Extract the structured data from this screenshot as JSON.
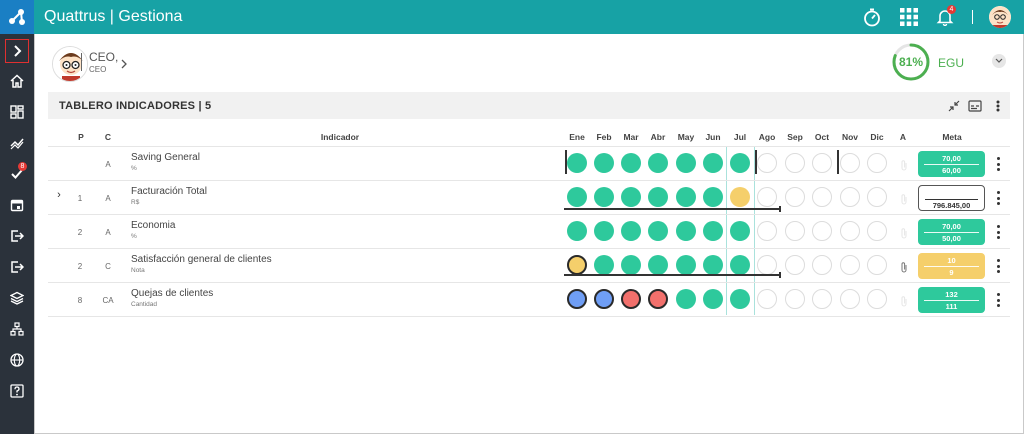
{
  "header": {
    "title": "Quattrus | Gestiona",
    "bell_count": "4"
  },
  "sidebar": {
    "items": [
      {
        "icon": "chevron-right-icon"
      },
      {
        "icon": "home-icon"
      },
      {
        "icon": "dashboard-icon"
      },
      {
        "icon": "trend-icon"
      },
      {
        "icon": "tasks-icon",
        "badge": "8"
      },
      {
        "icon": "calendar-icon"
      },
      {
        "icon": "exit-icon"
      },
      {
        "icon": "exit-icon"
      },
      {
        "icon": "layers-icon"
      },
      {
        "icon": "org-chart-icon"
      },
      {
        "icon": "globe-icon"
      },
      {
        "icon": "help-icon"
      }
    ]
  },
  "user": {
    "role": "CEO,",
    "sub": "CEO"
  },
  "score": {
    "percent": "81%",
    "value": 0.81,
    "unit": "EGU"
  },
  "panel": {
    "title": "TABLERO INDICADORES | 5"
  },
  "table": {
    "headers": {
      "p": "P",
      "c": "C",
      "indicador": "Indicador",
      "a": "A",
      "meta": "Meta"
    },
    "months": [
      "Ene",
      "Feb",
      "Mar",
      "Abr",
      "May",
      "Jun",
      "Jul",
      "Ago",
      "Sep",
      "Oct",
      "Nov",
      "Dic"
    ],
    "rows": [
      {
        "expand": "",
        "p": "",
        "c": "A",
        "name": "Saving General",
        "unit": "%",
        "statuses": [
          "green",
          "green",
          "green",
          "green",
          "green",
          "green",
          "green",
          "empty",
          "empty",
          "empty",
          "empty",
          "empty"
        ],
        "meta_top": "70,00",
        "meta_bottom": "60,00",
        "meta_style": "green"
      },
      {
        "expand": "›",
        "p": "1",
        "c": "A",
        "name": "Facturación Total",
        "unit": "R$",
        "statuses": [
          "green",
          "green",
          "green",
          "green",
          "green",
          "green",
          "yellow",
          "empty",
          "empty",
          "empty",
          "empty",
          "empty"
        ],
        "meta_top": "",
        "meta_bottom": "796.845,00",
        "meta_style": "white"
      },
      {
        "expand": "",
        "p": "2",
        "c": "A",
        "name": "Economia",
        "unit": "%",
        "statuses": [
          "green",
          "green",
          "green",
          "green",
          "green",
          "green",
          "green",
          "empty",
          "empty",
          "empty",
          "empty",
          "empty"
        ],
        "meta_top": "70,00",
        "meta_bottom": "50,00",
        "meta_style": "green"
      },
      {
        "expand": "",
        "p": "2",
        "c": "C",
        "name": "Satisfacción general de clientes",
        "unit": "Nota",
        "statuses": [
          "yellow",
          "green",
          "green",
          "green",
          "green",
          "green",
          "green",
          "empty",
          "empty",
          "empty",
          "empty",
          "empty"
        ],
        "meta_top": "10",
        "meta_bottom": "9",
        "meta_style": "yellow",
        "attachment": true
      },
      {
        "expand": "",
        "p": "8",
        "c": "CA",
        "name": "Quejas de clientes",
        "unit": "Cantidad",
        "statuses": [
          "blue",
          "blue",
          "red",
          "red",
          "green",
          "green",
          "green",
          "empty",
          "empty",
          "empty",
          "empty",
          "empty"
        ],
        "meta_top": "132",
        "meta_bottom": "111",
        "meta_style": "green"
      }
    ]
  },
  "colors": {
    "teal": "#17a2a5",
    "sidebar": "#2b323b",
    "green": "#2ec99c",
    "yellow": "#f5cf6b",
    "red": "#f2706c",
    "blue": "#6f9ef5"
  }
}
